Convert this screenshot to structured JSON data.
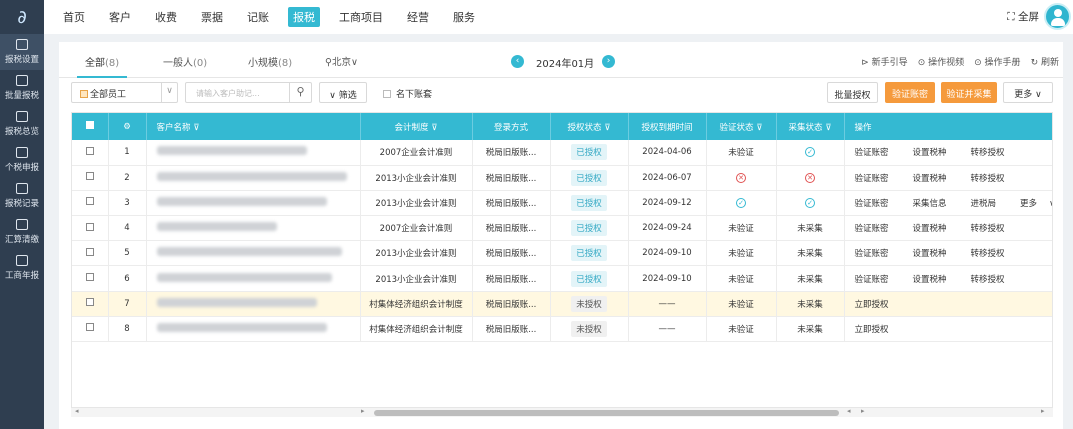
{
  "sidebar": {
    "items": [
      {
        "label": "报税设置",
        "icon": "settings-icon"
      },
      {
        "label": "批量报税",
        "icon": "batch-tax-icon"
      },
      {
        "label": "报税总览",
        "icon": "overview-icon"
      },
      {
        "label": "个税申报",
        "icon": "person-tax-icon"
      },
      {
        "label": "报税记录",
        "icon": "record-icon"
      },
      {
        "label": "汇算清缴",
        "icon": "settlement-icon"
      },
      {
        "label": "工商年报",
        "icon": "annual-report-icon"
      }
    ]
  },
  "nav": {
    "items": [
      "首页",
      "客户",
      "收费",
      "票据",
      "记账",
      "报税",
      "工商项目",
      "经营",
      "服务"
    ],
    "active": "报税",
    "fullscreen": "全屏"
  },
  "tabs": [
    {
      "label": "全部",
      "count": "(8)"
    },
    {
      "label": "一般人",
      "count": "(0)"
    },
    {
      "label": "小规模",
      "count": "(8)"
    }
  ],
  "region": "北京",
  "month": "2024年01月",
  "help_links": [
    "新手引导",
    "操作视频",
    "操作手册",
    "刷新"
  ],
  "filters": {
    "employee": "全部员工",
    "search_placeholder": "请输入客户助记...",
    "filter_label": "筛选",
    "sub_account_label": "名下账套"
  },
  "actions": {
    "batch_auth": "批量授权",
    "verify_password": "验证账密",
    "verify_collect": "验证并采集",
    "more": "更多"
  },
  "table": {
    "headers": [
      "",
      "",
      "客户名称",
      "会计制度",
      "登录方式",
      "授权状态",
      "授权到期时间",
      "验证状态",
      "采集状态",
      "操作"
    ],
    "rows": [
      {
        "no": "1",
        "system": "2007企业会计准则",
        "login": "税局旧版账...",
        "auth": "已授权",
        "expire": "2024-04-06",
        "verify": "未验证",
        "collect": "ok",
        "ops": [
          "验证账密",
          "设置税种",
          "转移授权"
        ]
      },
      {
        "no": "2",
        "system": "2013小企业会计准则",
        "login": "税局旧版账...",
        "auth": "已授权",
        "expire": "2024-06-07",
        "verify": "err",
        "collect": "err",
        "ops": [
          "验证账密",
          "设置税种",
          "转移授权"
        ]
      },
      {
        "no": "3",
        "system": "2013小企业会计准则",
        "login": "税局旧版账...",
        "auth": "已授权",
        "expire": "2024-09-12",
        "verify": "ok",
        "collect": "ok",
        "ops": [
          "验证账密",
          "采集信息",
          "进税局",
          "更多"
        ]
      },
      {
        "no": "4",
        "system": "2007企业会计准则",
        "login": "税局旧版账...",
        "auth": "已授权",
        "expire": "2024-09-24",
        "verify": "未验证",
        "collect": "未采集",
        "ops": [
          "验证账密",
          "设置税种",
          "转移授权"
        ]
      },
      {
        "no": "5",
        "system": "2013小企业会计准则",
        "login": "税局旧版账...",
        "auth": "已授权",
        "expire": "2024-09-10",
        "verify": "未验证",
        "collect": "未采集",
        "ops": [
          "验证账密",
          "设置税种",
          "转移授权"
        ]
      },
      {
        "no": "6",
        "system": "2013小企业会计准则",
        "login": "税局旧版账...",
        "auth": "已授权",
        "expire": "2024-09-10",
        "verify": "未验证",
        "collect": "未采集",
        "ops": [
          "验证账密",
          "设置税种",
          "转移授权"
        ]
      },
      {
        "no": "7",
        "system": "村集体经济组织会计制度",
        "login": "税局旧版账...",
        "auth": "未授权",
        "expire": "——",
        "verify": "未验证",
        "collect": "未采集",
        "ops": [
          "立即授权"
        ],
        "highlight": true
      },
      {
        "no": "8",
        "system": "村集体经济组织会计制度",
        "login": "税局旧版账...",
        "auth": "未授权",
        "expire": "——",
        "verify": "未验证",
        "collect": "未采集",
        "ops": [
          "立即授权"
        ]
      }
    ]
  },
  "colors": {
    "primary": "#34b9d2",
    "orange": "#f59a3c",
    "sidebar": "#2f3e50"
  }
}
